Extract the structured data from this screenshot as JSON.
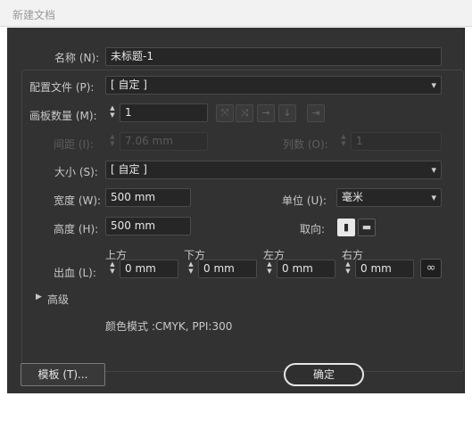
{
  "window": {
    "title": "新建文档"
  },
  "form": {
    "name_label": "名称 (N):",
    "name_value": "未标题-1",
    "profile_label": "配置文件 (P):",
    "profile_value": "[ 自定 ]",
    "artboards_label": "画板数量 (M):",
    "artboards_value": "1",
    "spacing_label": "间距 (I):",
    "spacing_value": "7.06 mm",
    "columns_label": "列数 (O):",
    "columns_value": "1",
    "size_label": "大小 (S):",
    "size_value": "[ 自定 ]",
    "width_label": "宽度 (W):",
    "width_value": "500 mm",
    "units_label": "单位 (U):",
    "units_value": "毫米",
    "height_label": "高度 (H):",
    "height_value": "500 mm",
    "orientation_label": "取向:",
    "bleed_label": "出血 (L):",
    "bleed_top_label": "上方",
    "bleed_bottom_label": "下方",
    "bleed_left_label": "左方",
    "bleed_right_label": "右方",
    "bleed_top_value": "0 mm",
    "bleed_bottom_value": "0 mm",
    "bleed_left_value": "0 mm",
    "bleed_right_value": "0 mm",
    "advanced_label": "高级",
    "color_mode_text": "颜色模式 :CMYK, PPI:300"
  },
  "buttons": {
    "templates_label": "模板 (T)...",
    "ok_label": "确定"
  },
  "icons": {
    "chevron_down": "▾",
    "spin_up": "▲",
    "spin_down": "▼",
    "disclosure": "▶",
    "chain": "🔗"
  }
}
